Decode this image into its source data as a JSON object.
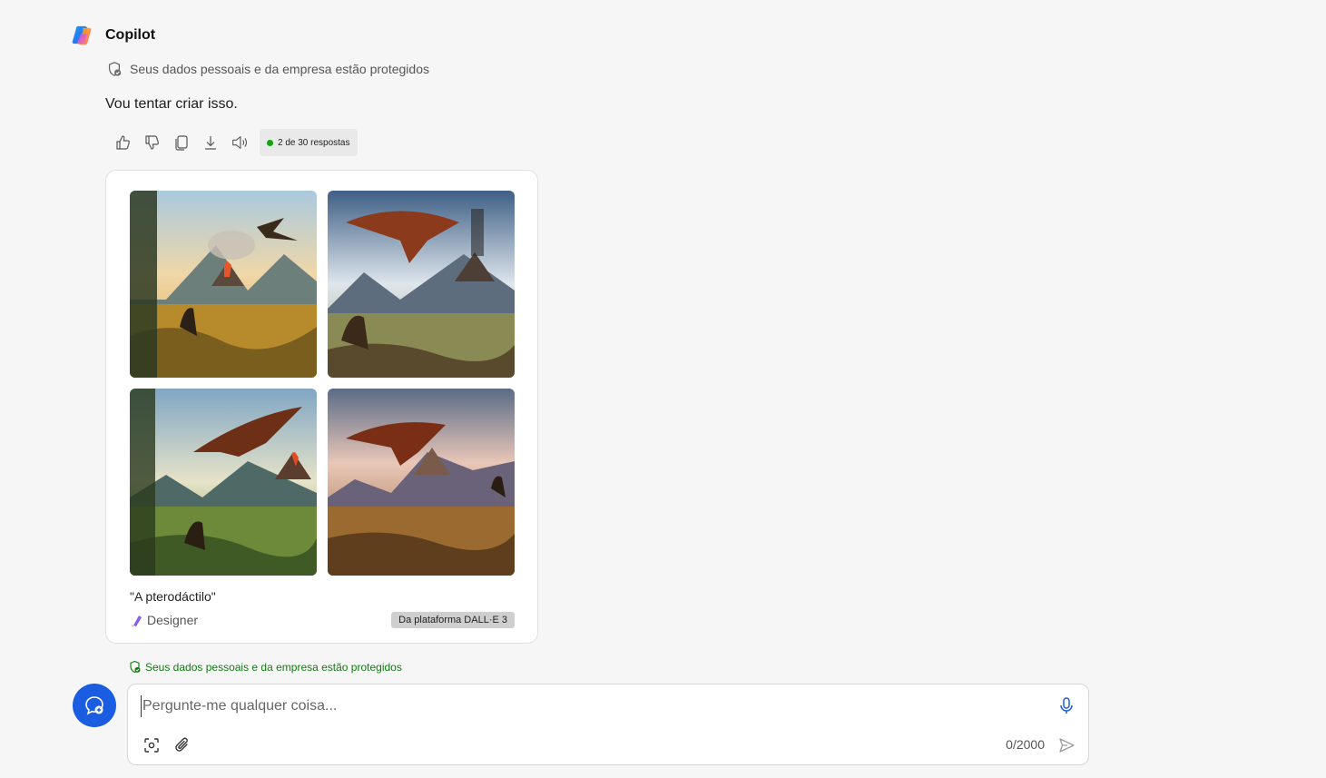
{
  "header": {
    "title": "Copilot",
    "logo_icon": "copilot-logo-icon"
  },
  "privacy_notice": "Seus dados pessoais e da empresa estão protegidos",
  "message": {
    "text": "Vou tentar criar isso."
  },
  "actions": {
    "items": [
      "thumbs-up-icon",
      "thumbs-down-icon",
      "copy-icon",
      "download-icon",
      "read-aloud-icon"
    ],
    "response_count": "2 de 30 respostas"
  },
  "image_card": {
    "images": [
      "pterodactyl-image-1",
      "pterodactyl-image-2",
      "pterodactyl-image-3",
      "pterodactyl-image-4"
    ],
    "caption": "\"A pterodáctilo\"",
    "source_label": "Designer",
    "platform_badge": "Da plataforma DALL·E 3"
  },
  "composer": {
    "placeholder": "Pergunte-me qualquer coisa...",
    "value": "",
    "char_counter": "0/2000",
    "accent": "#1b5de0"
  },
  "colors": {
    "background": "#f6f6f6",
    "protected_green": "#107c10",
    "new_topic_blue": "#1b5de0"
  }
}
